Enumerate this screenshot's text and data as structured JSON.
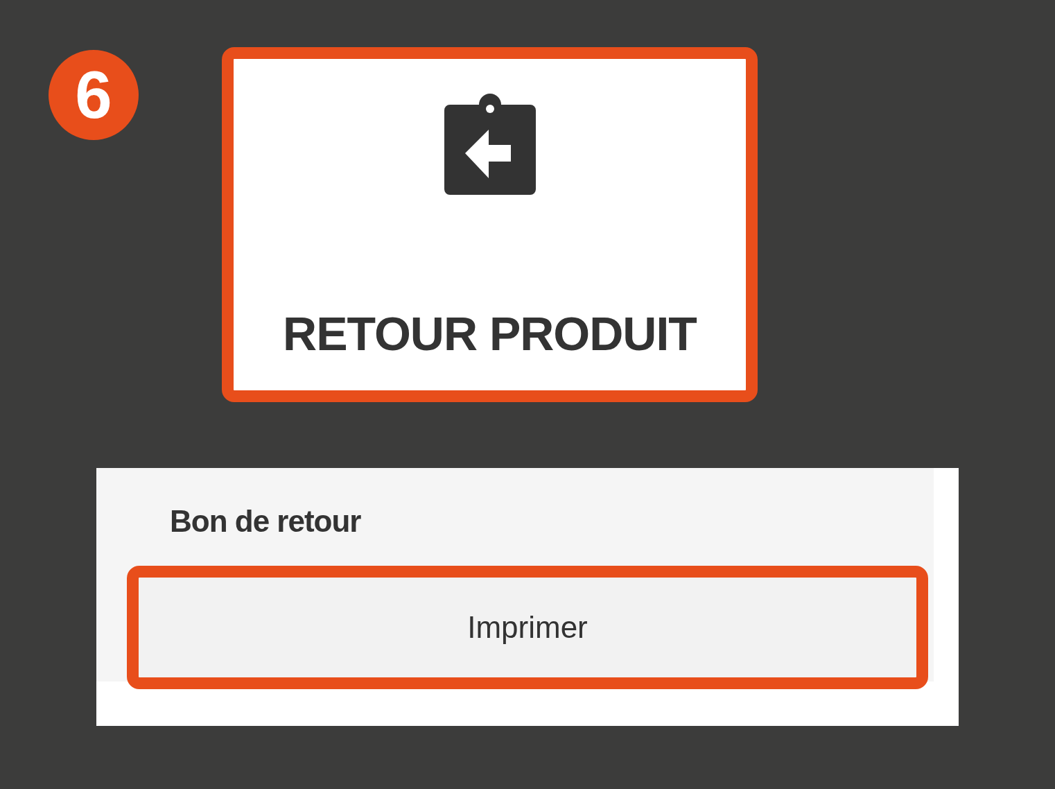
{
  "step_badge": "6",
  "tile": {
    "label": "RETOUR PRODUIT",
    "highlighted": true
  },
  "panel": {
    "title": "Bon de retour",
    "button": {
      "label": "Imprimer",
      "highlighted": true
    }
  }
}
